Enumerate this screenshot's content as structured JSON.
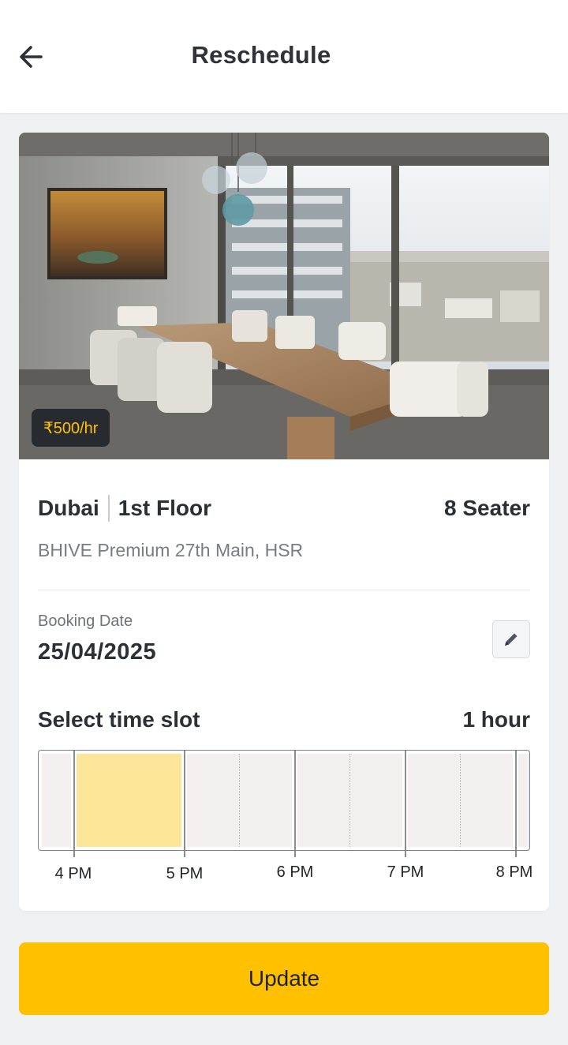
{
  "header": {
    "title": "Reschedule",
    "back_icon": "arrow-left-icon"
  },
  "room": {
    "price": "₹500/hr",
    "name": "Dubai",
    "floor": "1st Floor",
    "capacity": "8 Seater",
    "address": "BHIVE Premium 27th Main, HSR"
  },
  "booking": {
    "date_label": "Booking Date",
    "date": "25/04/2025",
    "edit_icon": "pencil-icon"
  },
  "time_slot": {
    "title": "Select time slot",
    "duration": "1 hour",
    "hour_labels": [
      "4 PM",
      "5 PM",
      "6 PM",
      "7 PM",
      "8 PM"
    ],
    "selected_index": 1
  },
  "actions": {
    "update_label": "Update"
  },
  "colors": {
    "accent": "#ffc000",
    "selected_slot": "#fde59a",
    "slot_bg": "#f2efee",
    "price_text": "#ffc200"
  }
}
